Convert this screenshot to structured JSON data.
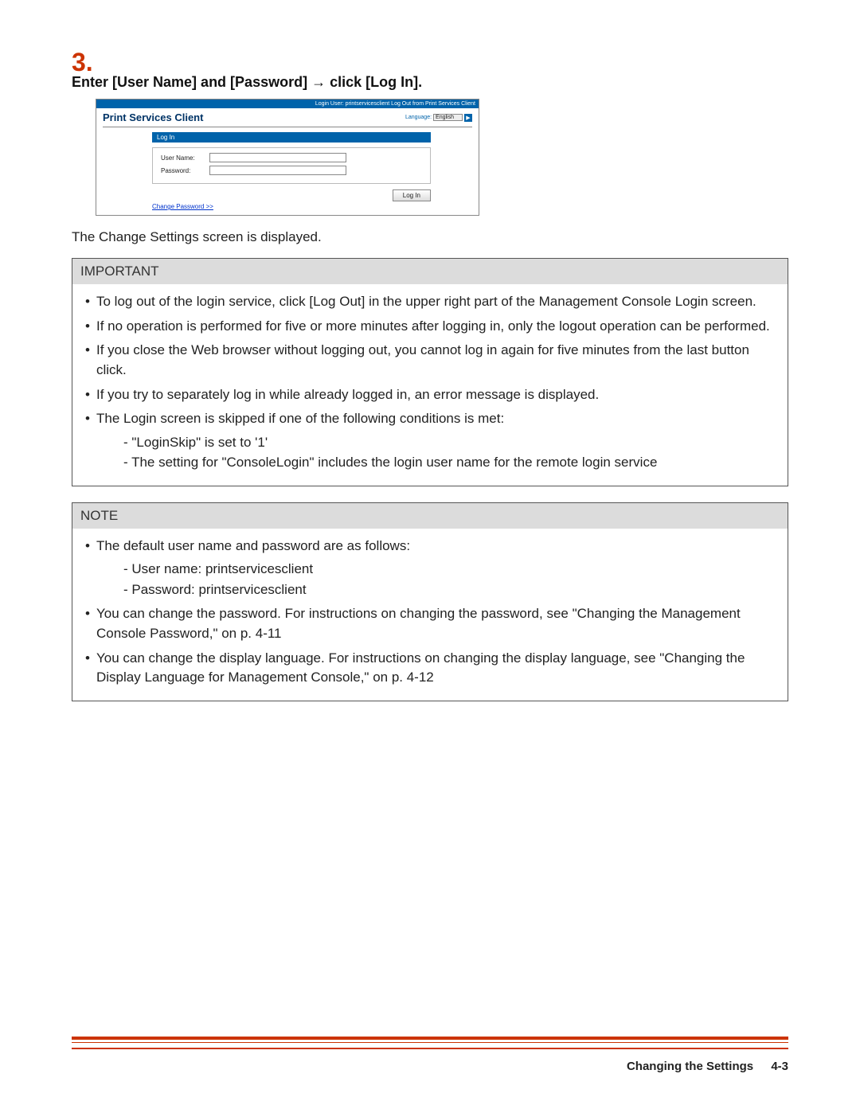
{
  "step": {
    "number": "3.",
    "title": "Enter [User Name] and [Password] → click [Log In]."
  },
  "screenshot": {
    "topbar": "Login User: printservicesclient   Log Out from Print Services Client",
    "app_title": "Print Services Client",
    "lang_label": "Language:",
    "lang_value": "English",
    "lang_go": "▶",
    "login_bar": "Log In",
    "username_label": "User Name:",
    "password_label": "Password:",
    "login_btn": "Log In",
    "change_pw_link": "Change Password >>"
  },
  "after_text": "The Change Settings screen is displayed.",
  "important": {
    "heading": "IMPORTANT",
    "items": [
      {
        "text": "To log out of the login service, click [Log Out] in the upper right part of the Management Console Login screen."
      },
      {
        "text": "If no operation is performed for five or more minutes after logging in, only the logout operation can be performed."
      },
      {
        "text": "If you close the Web browser without logging out, you cannot log in again for five minutes from the last button click."
      },
      {
        "text": "If you try to separately log in while already logged in, an error message is displayed."
      },
      {
        "text": "The Login screen is skipped if one of the following conditions is met:",
        "subs": [
          "\"LoginSkip\" is set to '1'",
          "The setting for \"ConsoleLogin\" includes the login user name for the remote login service"
        ]
      }
    ]
  },
  "note": {
    "heading": "NOTE",
    "items": [
      {
        "text": "The default user name and password are as follows:",
        "subs": [
          "User name: printservicesclient",
          "Password: printservicesclient"
        ]
      },
      {
        "text": "You can change the password. For instructions on changing the password, see \"Changing the Management Console Password,\" on p. 4-11"
      },
      {
        "text": "You can change the display language. For instructions on changing the display language, see \"Changing the Display Language for Management Console,\" on p. 4-12"
      }
    ]
  },
  "footer": {
    "label": "Changing the Settings",
    "page": "4-3"
  }
}
